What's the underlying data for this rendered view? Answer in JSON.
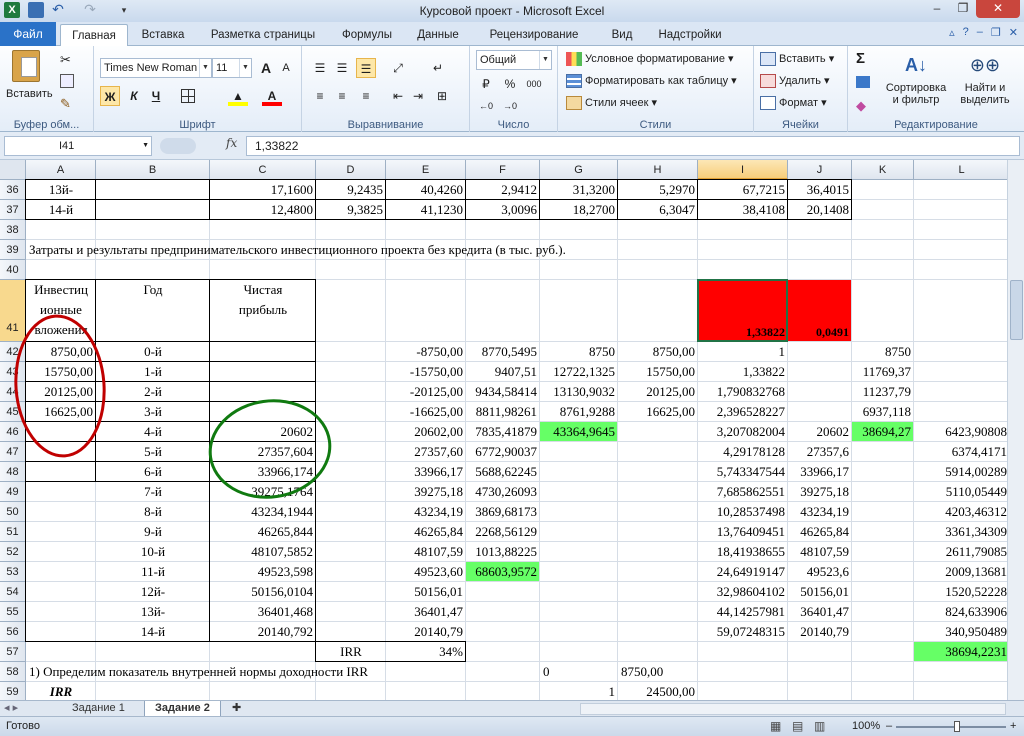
{
  "window": {
    "title": "Курсовой проект  -  Microsoft Excel",
    "logo": "X",
    "minimize": "–",
    "restore": "❐",
    "close": "✕"
  },
  "quick_access": {
    "undo": "↶",
    "redo": "↷",
    "more": "▾"
  },
  "tabs": [
    "Файл",
    "Главная",
    "Вставка",
    "Разметка страницы",
    "Формулы",
    "Данные",
    "Рецензирование",
    "Вид",
    "Надстройки"
  ],
  "ribbon": {
    "clipboard": {
      "paste": "Вставить",
      "label": "Буфер обм..."
    },
    "font": {
      "name": "Times New Roman",
      "size": "11",
      "bold": "Ж",
      "italic": "К",
      "underline": "Ч",
      "grow": "A",
      "shrink": "A",
      "label": "Шрифт"
    },
    "alignment": {
      "label": "Выравнивание"
    },
    "number": {
      "format": "Общий",
      "percent": "%",
      "thousands": "000",
      "label": "Число"
    },
    "styles": {
      "cond": "Условное форматирование",
      "table": "Форматировать как таблицу",
      "cell": "Стили ячеек",
      "label": "Стили"
    },
    "cells": {
      "insert": "Вставить",
      "delete": "Удалить",
      "format": "Формат",
      "label": "Ячейки"
    },
    "editing": {
      "sum": "Σ",
      "sort1": "Сортировка",
      "sort2": "и фильтр",
      "find1": "Найти и",
      "find2": "выделить",
      "label": "Редактирование"
    }
  },
  "formula_bar": {
    "name_box": "I41",
    "fx": "fx",
    "formula": "1,33822"
  },
  "columns": [
    "A",
    "B",
    "C",
    "D",
    "E",
    "F",
    "G",
    "H",
    "I",
    "J",
    "K",
    "L"
  ],
  "rows": [
    "36",
    "37",
    "38",
    "39",
    "40",
    "41",
    "42",
    "43",
    "44",
    "45",
    "46",
    "47",
    "48",
    "49",
    "50",
    "51",
    "52",
    "53",
    "54",
    "55",
    "56",
    "57",
    "58",
    "59"
  ],
  "cells": {
    "r36": {
      "A": "13й-",
      "C": "17,1600",
      "D": "9,2435",
      "E": "40,4260",
      "F": "2,9412",
      "G": "31,3200",
      "H": "5,2970",
      "I": "67,7215",
      "J": "36,4015"
    },
    "r37": {
      "A": "14-й",
      "C": "12,4800",
      "D": "9,3825",
      "E": "41,1230",
      "F": "3,0096",
      "G": "18,2700",
      "H": "6,3047",
      "I": "38,4108",
      "J": "20,1408"
    },
    "r39": {
      "A": "Затраты и результаты предпринимательского инвестиционного проекта без кредита (в тыс. руб.)."
    },
    "r41": {
      "A1": "Инвестиц",
      "A2": "ионные",
      "A3": "вложения",
      "B": "Год",
      "C1": "Чистая",
      "C2": "прибыль",
      "I": "1,33822",
      "J": "0,0491"
    },
    "r42": {
      "A": "8750,00",
      "B": "0-й",
      "E": "-8750,00",
      "F": "8770,5495",
      "G": "8750",
      "H": "8750,00",
      "I": "1",
      "K": "8750"
    },
    "r43": {
      "A": "15750,00",
      "B": "1-й",
      "E": "-15750,00",
      "F": "9407,51",
      "G": "12722,1325",
      "H": "15750,00",
      "I": "1,33822",
      "K": "11769,37"
    },
    "r44": {
      "A": "20125,00",
      "B": "2-й",
      "E": "-20125,00",
      "F": "9434,58414",
      "G": "13130,9032",
      "H": "20125,00",
      "I": "1,790832768",
      "K": "11237,79"
    },
    "r45": {
      "A": "16625,00",
      "B": "3-й",
      "E": "-16625,00",
      "F": "8811,98261",
      "G": "8761,9288",
      "H": "16625,00",
      "I": "2,396528227",
      "K": "6937,118"
    },
    "r46": {
      "B": "4-й",
      "C": "20602",
      "E": "20602,00",
      "F": "7835,41879",
      "G": "43364,9645",
      "I": "3,207082004",
      "J": "20602",
      "K": "38694,27",
      "L": "6423,90808"
    },
    "r47": {
      "B": "5-й",
      "C": "27357,604",
      "E": "27357,60",
      "F": "6772,90037",
      "I": "4,29178128",
      "J": "27357,6",
      "L": "6374,4171"
    },
    "r48": {
      "B": "6-й",
      "C": "33966,174",
      "E": "33966,17",
      "F": "5688,62245",
      "I": "5,743347544",
      "J": "33966,17",
      "L": "5914,00289"
    },
    "r49": {
      "B": "7-й",
      "C": "39275,1764",
      "E": "39275,18",
      "F": "4730,26093",
      "I": "7,685862551",
      "J": "39275,18",
      "L": "5110,05449"
    },
    "r50": {
      "B": "8-й",
      "C": "43234,1944",
      "E": "43234,19",
      "F": "3869,68173",
      "I": "10,28537498",
      "J": "43234,19",
      "L": "4203,46312"
    },
    "r51": {
      "B": "9-й",
      "C": "46265,844",
      "E": "46265,84",
      "F": "2268,56129",
      "I": "13,76409451",
      "J": "46265,84",
      "L": "3361,34309"
    },
    "r52": {
      "B": "10-й",
      "C": "48107,5852",
      "E": "48107,59",
      "F": "1013,88225",
      "I": "18,41938655",
      "J": "48107,59",
      "L": "2611,79085"
    },
    "r53": {
      "B": "11-й",
      "C": "49523,598",
      "E": "49523,60",
      "F": "68603,9572",
      "I": "24,64919147",
      "J": "49523,6",
      "L": "2009,13681"
    },
    "r54": {
      "B": "12й-",
      "C": "50156,0104",
      "E": "50156,01",
      "I": "32,98604102",
      "J": "50156,01",
      "L": "1520,52228"
    },
    "r55": {
      "B": "13й-",
      "C": "36401,468",
      "E": "36401,47",
      "I": "44,14257981",
      "J": "36401,47",
      "L": "824,633906"
    },
    "r56": {
      "B": "14-й",
      "C": "20140,792",
      "E": "20140,79",
      "I": "59,07248315",
      "J": "20140,79",
      "L": "340,950489"
    },
    "r57": {
      "D": "IRR",
      "E": "34%",
      "L": "38694,2231"
    },
    "r58": {
      "A": "1) Определим показатель внутренней нормы доходности IRR",
      "G": "0",
      "H": "8750,00"
    },
    "r59": {
      "A": "IRR",
      "G": "1",
      "H": "24500,00"
    }
  },
  "sheets": [
    "Задание 1",
    "Задание 2"
  ],
  "status": {
    "ready": "Готово",
    "zoom": "100%",
    "zoom_minus": "–",
    "zoom_plus": "+"
  },
  "colors": {
    "red_fill": "#ff0000",
    "green_fill": "#66ff66",
    "red_circle": "#c00000",
    "green_circle": "#107a10",
    "selection": "#217346"
  }
}
